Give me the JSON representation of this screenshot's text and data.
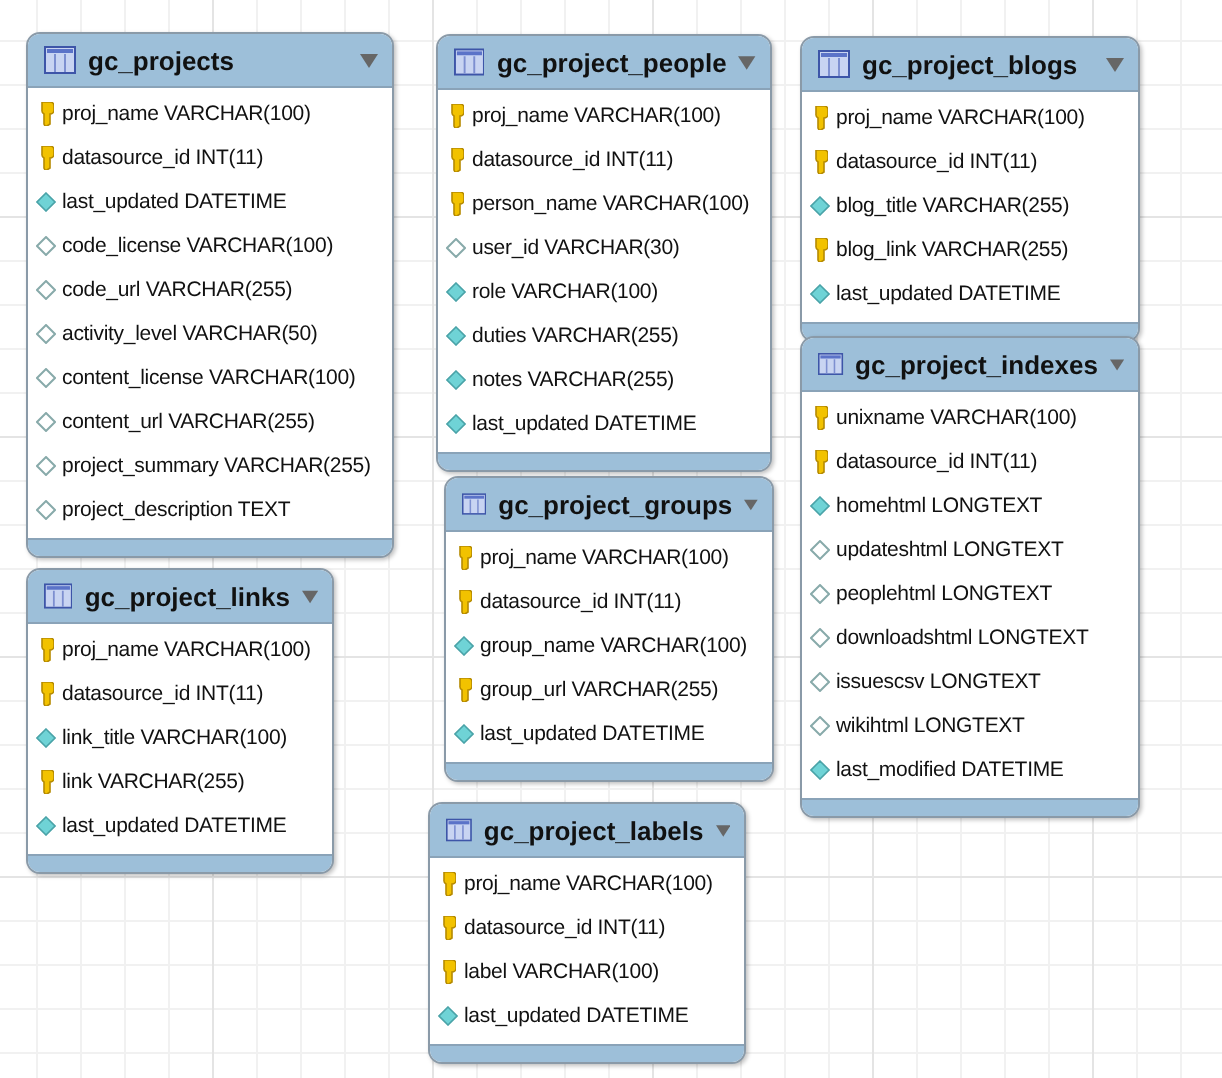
{
  "tables": [
    {
      "name": "gc_projects",
      "columns": [
        {
          "kind": "key",
          "text": "proj_name VARCHAR(100)"
        },
        {
          "kind": "key",
          "text": "datasource_id INT(11)"
        },
        {
          "kind": "required",
          "text": "last_updated DATETIME"
        },
        {
          "kind": "optional",
          "text": "code_license VARCHAR(100)"
        },
        {
          "kind": "optional",
          "text": "code_url VARCHAR(255)"
        },
        {
          "kind": "optional",
          "text": "activity_level VARCHAR(50)"
        },
        {
          "kind": "optional",
          "text": "content_license VARCHAR(100)"
        },
        {
          "kind": "optional",
          "text": "content_url VARCHAR(255)"
        },
        {
          "kind": "optional",
          "text": "project_summary VARCHAR(255)"
        },
        {
          "kind": "optional",
          "text": "project_description TEXT"
        }
      ]
    },
    {
      "name": "gc_project_people",
      "columns": [
        {
          "kind": "key",
          "text": "proj_name VARCHAR(100)"
        },
        {
          "kind": "key",
          "text": "datasource_id INT(11)"
        },
        {
          "kind": "key",
          "text": "person_name VARCHAR(100)"
        },
        {
          "kind": "optional",
          "text": "user_id VARCHAR(30)"
        },
        {
          "kind": "required",
          "text": "role VARCHAR(100)"
        },
        {
          "kind": "required",
          "text": "duties VARCHAR(255)"
        },
        {
          "kind": "required",
          "text": "notes VARCHAR(255)"
        },
        {
          "kind": "required",
          "text": "last_updated DATETIME"
        }
      ]
    },
    {
      "name": "gc_project_blogs",
      "columns": [
        {
          "kind": "key",
          "text": "proj_name VARCHAR(100)"
        },
        {
          "kind": "key",
          "text": "datasource_id INT(11)"
        },
        {
          "kind": "required",
          "text": "blog_title VARCHAR(255)"
        },
        {
          "kind": "key",
          "text": "blog_link VARCHAR(255)"
        },
        {
          "kind": "required",
          "text": "last_updated DATETIME"
        }
      ]
    },
    {
      "name": "gc_project_indexes",
      "columns": [
        {
          "kind": "key",
          "text": "unixname VARCHAR(100)"
        },
        {
          "kind": "key",
          "text": "datasource_id INT(11)"
        },
        {
          "kind": "required",
          "text": "homehtml LONGTEXT"
        },
        {
          "kind": "optional",
          "text": "updateshtml LONGTEXT"
        },
        {
          "kind": "optional",
          "text": "peoplehtml LONGTEXT"
        },
        {
          "kind": "optional",
          "text": "downloadshtml LONGTEXT"
        },
        {
          "kind": "optional",
          "text": "issuescsv LONGTEXT"
        },
        {
          "kind": "optional",
          "text": "wikihtml LONGTEXT"
        },
        {
          "kind": "required",
          "text": "last_modified DATETIME"
        }
      ]
    },
    {
      "name": "gc_project_links",
      "columns": [
        {
          "kind": "key",
          "text": "proj_name VARCHAR(100)"
        },
        {
          "kind": "key",
          "text": "datasource_id INT(11)"
        },
        {
          "kind": "required",
          "text": "link_title VARCHAR(100)"
        },
        {
          "kind": "key",
          "text": "link VARCHAR(255)"
        },
        {
          "kind": "required",
          "text": "last_updated DATETIME"
        }
      ]
    },
    {
      "name": "gc_project_groups",
      "columns": [
        {
          "kind": "key",
          "text": "proj_name VARCHAR(100)"
        },
        {
          "kind": "key",
          "text": "datasource_id INT(11)"
        },
        {
          "kind": "required",
          "text": "group_name VARCHAR(100)"
        },
        {
          "kind": "key",
          "text": "group_url VARCHAR(255)"
        },
        {
          "kind": "required",
          "text": "last_updated DATETIME"
        }
      ]
    },
    {
      "name": "gc_project_labels",
      "columns": [
        {
          "kind": "key",
          "text": "proj_name VARCHAR(100)"
        },
        {
          "kind": "key",
          "text": "datasource_id INT(11)"
        },
        {
          "kind": "key",
          "text": "label VARCHAR(100)"
        },
        {
          "kind": "required",
          "text": "last_updated DATETIME"
        }
      ]
    }
  ]
}
